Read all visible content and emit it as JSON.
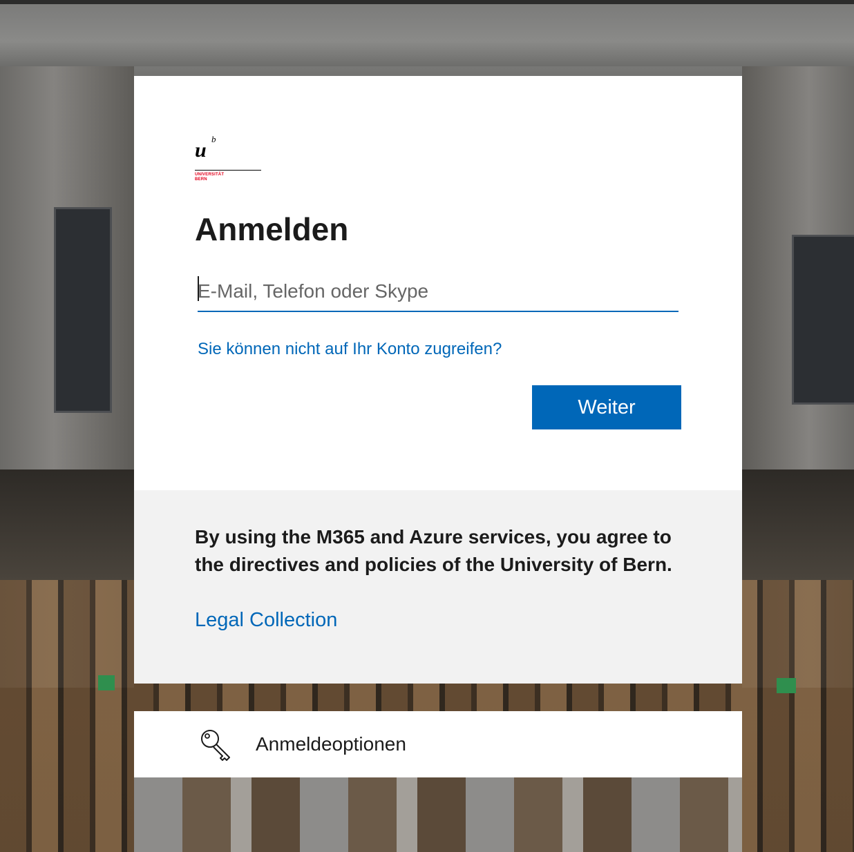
{
  "signin": {
    "logo": {
      "mark": "u",
      "superscript": "b",
      "line1": "UNIVERSITÄT",
      "line2": "BERN",
      "brand_color": "#e3001b"
    },
    "title": "Anmelden",
    "email_placeholder": "E-Mail, Telefon oder Skype",
    "email_value": "",
    "help_link": "Sie können nicht auf Ihr Konto zugreifen?",
    "next_button": "Weiter"
  },
  "notice": {
    "text": "By using the M365 and Azure services, you agree to the directives and policies of the University of Bern.",
    "link": "Legal Collection"
  },
  "options": {
    "icon": "key-icon",
    "label": "Anmeldeoptionen"
  },
  "colors": {
    "accent": "#0067b8",
    "card_bg": "#ffffff",
    "notice_bg": "#f2f2f2",
    "text": "#1b1b1b"
  }
}
